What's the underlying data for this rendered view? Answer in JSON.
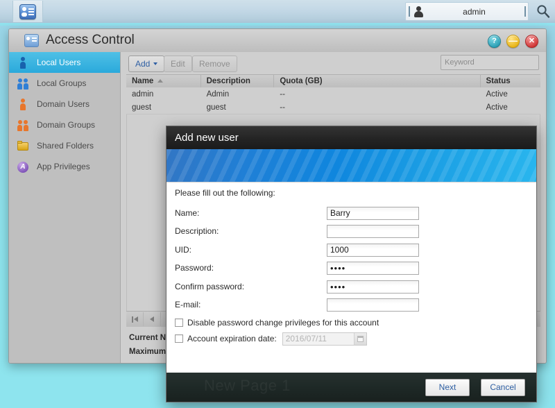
{
  "taskbar": {
    "app_icon": "id-card-icon",
    "user_name": "admin",
    "search_icon": "search-icon"
  },
  "window": {
    "title": "Access Control",
    "icon": "id-card-icon",
    "controls": {
      "help": "?",
      "minimize": "—",
      "close": "✕"
    }
  },
  "sidebar": {
    "items": [
      {
        "label": "Local Users",
        "icon": "user-icon",
        "active": true
      },
      {
        "label": "Local Groups",
        "icon": "users-group-icon",
        "active": false
      },
      {
        "label": "Domain Users",
        "icon": "domain-user-icon",
        "active": false
      },
      {
        "label": "Domain Groups",
        "icon": "domain-group-icon",
        "active": false
      },
      {
        "label": "Shared Folders",
        "icon": "folder-icon",
        "active": false
      },
      {
        "label": "App Privileges",
        "icon": "app-privileges-icon",
        "active": false
      }
    ]
  },
  "toolbar": {
    "add_label": "Add",
    "edit_label": "Edit",
    "remove_label": "Remove",
    "keyword_placeholder": "Keyword"
  },
  "table": {
    "columns": [
      "Name",
      "Description",
      "Quota (GB)",
      "Status"
    ],
    "sorted_column": "Name",
    "sort_direction": "asc",
    "rows": [
      {
        "name": "admin",
        "description": "Admin",
        "quota": "--",
        "status": "Active"
      },
      {
        "name": "guest",
        "description": "guest",
        "quota": "--",
        "status": "Active"
      }
    ]
  },
  "pager": {
    "first_icon": "first-page-icon",
    "prev_icon": "previous-page-icon"
  },
  "status": {
    "current_label": "Current Num",
    "maximum_label": "Maximum N"
  },
  "dialog": {
    "title": "Add new user",
    "hint": "Please fill out the following:",
    "fields": [
      {
        "label": "Name:",
        "value": "Barry",
        "type": "text"
      },
      {
        "label": "Description:",
        "value": "",
        "type": "text"
      },
      {
        "label": "UID:",
        "value": "1000",
        "type": "text"
      },
      {
        "label": "Password:",
        "value": "••••",
        "type": "password"
      },
      {
        "label": "Confirm password:",
        "value": "••••",
        "type": "password"
      },
      {
        "label": "E-mail:",
        "value": "",
        "type": "text"
      }
    ],
    "checkboxes": [
      {
        "label": "Disable password change privileges for this account",
        "checked": false
      },
      {
        "label": "Account expiration date:",
        "checked": false
      }
    ],
    "expiration_date": "2016/07/11",
    "calendar_icon": "calendar-icon",
    "watermark": "New Page 1",
    "next_label": "Next",
    "cancel_label": "Cancel"
  },
  "colors": {
    "desktop": "#8ddfe9",
    "accent_blue": "#2aa9db",
    "banner_blue": "#0f86de",
    "link_text": "#2e5fa3",
    "dialog_title_bg": "#242424",
    "dialog_footer_bg": "#1d2725"
  }
}
